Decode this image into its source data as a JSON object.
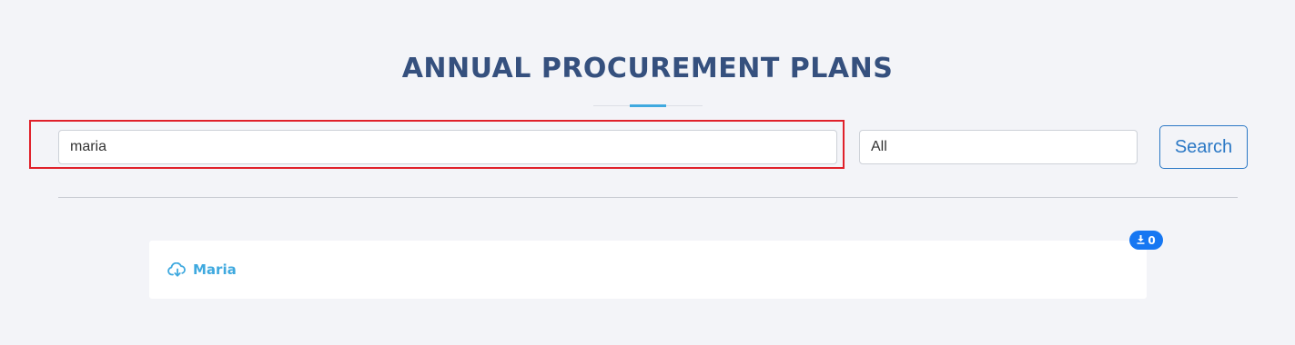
{
  "page": {
    "title": "ANNUAL PROCUREMENT PLANS"
  },
  "search": {
    "query": "maria",
    "category": "All",
    "button_label": "Search"
  },
  "results": [
    {
      "label": "Maria",
      "icon": "cloud-download-icon",
      "download_count": "0"
    }
  ],
  "colors": {
    "title": "#35507e",
    "accent": "#3fa9df",
    "button": "#2b78c5",
    "badge": "#1677f2",
    "highlight": "#e0212b",
    "background": "#f3f4f8"
  }
}
